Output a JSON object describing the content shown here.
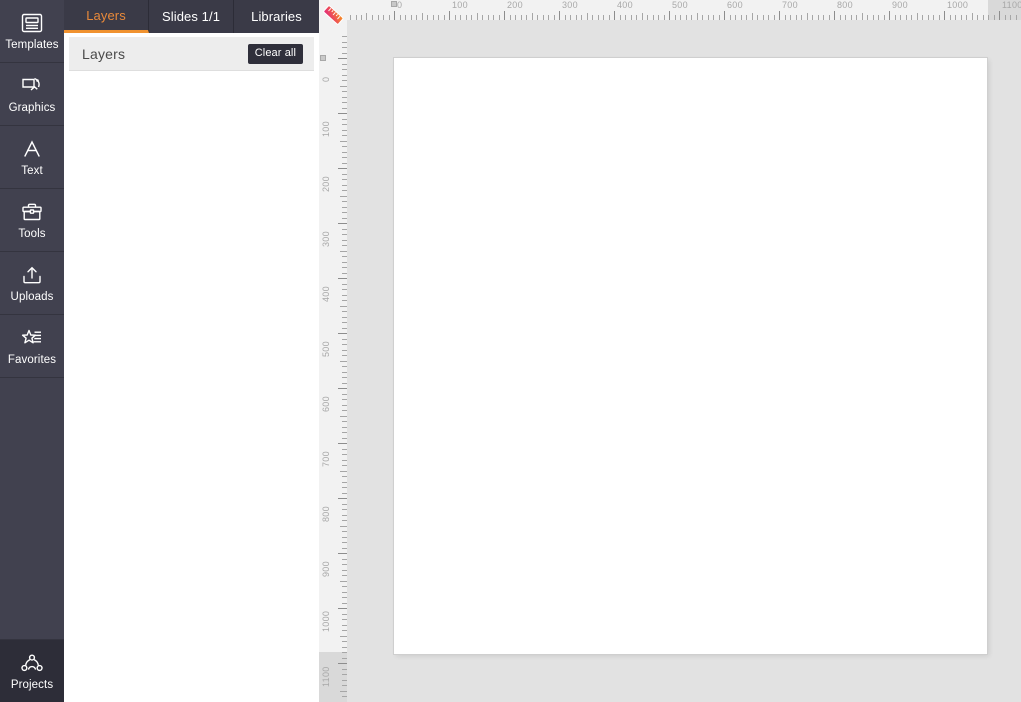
{
  "app": {
    "workspace_bg": "#e2e2e2",
    "accent": "#f0922f",
    "sidebar_bg": "#41414f"
  },
  "sidebar": {
    "items": [
      {
        "id": "templates",
        "label": "Templates",
        "icon": "templates-icon",
        "active": false
      },
      {
        "id": "graphics",
        "label": "Graphics",
        "icon": "graphics-icon",
        "active": false
      },
      {
        "id": "text",
        "label": "Text",
        "icon": "text-icon",
        "active": false
      },
      {
        "id": "tools",
        "label": "Tools",
        "icon": "toolbox-icon",
        "active": false
      },
      {
        "id": "uploads",
        "label": "Uploads",
        "icon": "upload-icon",
        "active": false
      },
      {
        "id": "favorites",
        "label": "Favorites",
        "icon": "star-list-icon",
        "active": false
      }
    ],
    "bottom_item": {
      "id": "projects",
      "label": "Projects",
      "icon": "projects-icon",
      "active": true
    }
  },
  "panel": {
    "tabs": [
      {
        "id": "layers",
        "label": "Layers",
        "active": true
      },
      {
        "id": "slides",
        "label": "Slides 1/1",
        "active": false
      },
      {
        "id": "libraries",
        "label": "Libraries",
        "active": false
      }
    ],
    "layers_header": {
      "title": "Layers",
      "clear_all_label": "Clear all"
    },
    "layers_items": []
  },
  "rulers": {
    "corner_icon": "ruler-icon",
    "unit_labels_top": [
      "0",
      "100",
      "200",
      "300",
      "400",
      "500",
      "600",
      "700",
      "800",
      "900",
      "1000",
      "1100"
    ],
    "unit_labels_left": [
      "0",
      "100",
      "200",
      "300",
      "400",
      "500",
      "600",
      "700",
      "800",
      "900",
      "1000",
      "1100"
    ],
    "origin_x": 0,
    "origin_y": 0,
    "zoom_percent": 55,
    "major_step_units": 100,
    "minor_step_units": 10
  },
  "canvas": {
    "width_units": 1080,
    "height_units": 1080,
    "background": "#ffffff",
    "content": []
  }
}
